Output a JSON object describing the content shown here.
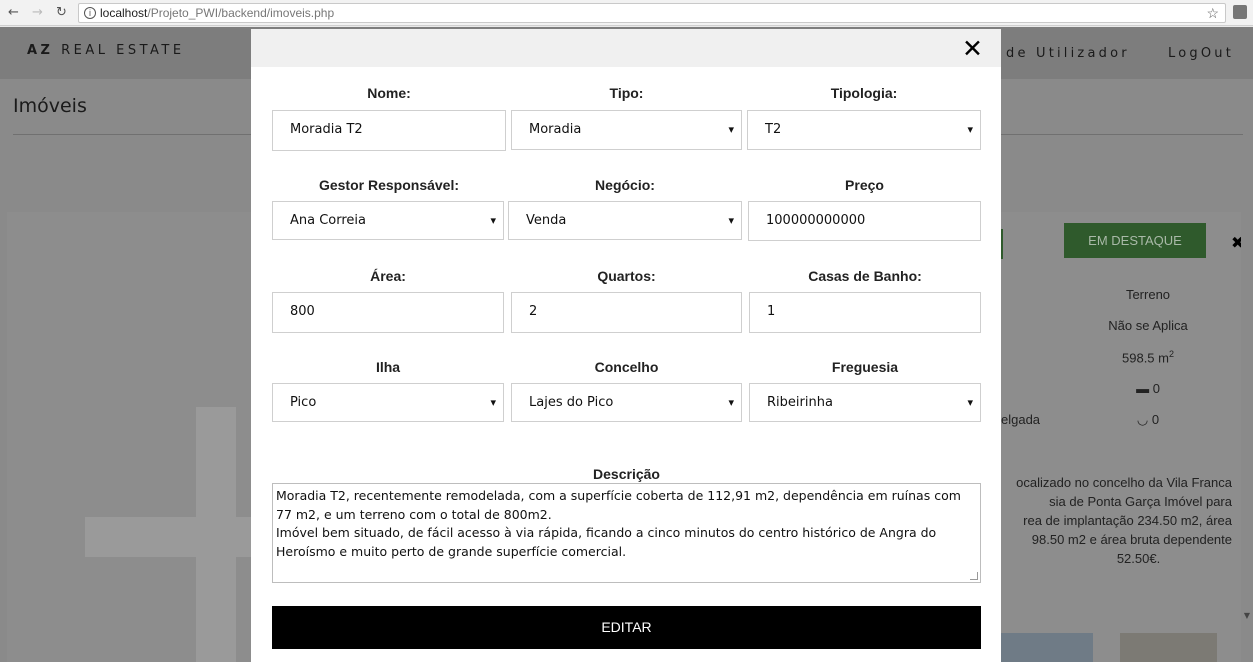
{
  "browser": {
    "url_host": "localhost",
    "url_path": "/Projeto_PWI/backend/imoveis.php",
    "back_icon": "arrow-left-icon",
    "forward_icon": "arrow-right-icon",
    "reload_icon": "reload-icon",
    "info_icon": "info-icon",
    "star_icon": "star-icon"
  },
  "header": {
    "brand_bold": "AZ",
    "brand_rest": "REAL ESTATE",
    "nav_user": "de Utilizador",
    "nav_logout": "LogOut"
  },
  "page": {
    "title": "Imóveis",
    "featured_button": "EM DESTAQUE",
    "close_glyph": "✖",
    "details": {
      "type": "Terreno",
      "typology": "Não se Aplica",
      "area": "598.5 m",
      "area_sup": "2",
      "bedrooms": "0",
      "bathrooms": "0",
      "parish_fragment": "elgada"
    },
    "description_fragment": [
      "ocalizado no concelho da Vila Franca",
      "sia de Ponta Garça Imóvel para",
      "rea de implantação 234.50 m2, área",
      "98.50 m2 e área bruta dependente",
      "52.50€."
    ]
  },
  "modal": {
    "close_glyph": "✕",
    "labels": {
      "nome": "Nome:",
      "tipo": "Tipo:",
      "tipologia": "Tipologia:",
      "gestor": "Gestor Responsável:",
      "negocio": "Negócio:",
      "preco": "Preço",
      "area": "Área:",
      "quartos": "Quartos:",
      "casas_banho": "Casas de Banho:",
      "ilha": "Ilha",
      "concelho": "Concelho",
      "freguesia": "Freguesia",
      "descricao": "Descrição"
    },
    "values": {
      "nome": "Moradia T2",
      "tipo": "Moradia",
      "tipologia": "T2",
      "gestor": "Ana Correia",
      "negocio": "Venda",
      "preco": "100000000000",
      "area": "800",
      "quartos": "2",
      "casas_banho": "1",
      "ilha": "Pico",
      "concelho": "Lajes do Pico",
      "freguesia": "Ribeirinha",
      "descricao": "Moradia T2, recentemente remodelada, com a superfície coberta de 112,91 m2, dependência em ruínas com 77 m2, e um terreno com o total de 800m2.\nImóvel bem situado, de fácil acesso à via rápida, ficando a cinco minutos do centro histórico de Angra do Heroísmo e muito perto de grande superfície comercial."
    },
    "submit_label": "EDITAR"
  }
}
